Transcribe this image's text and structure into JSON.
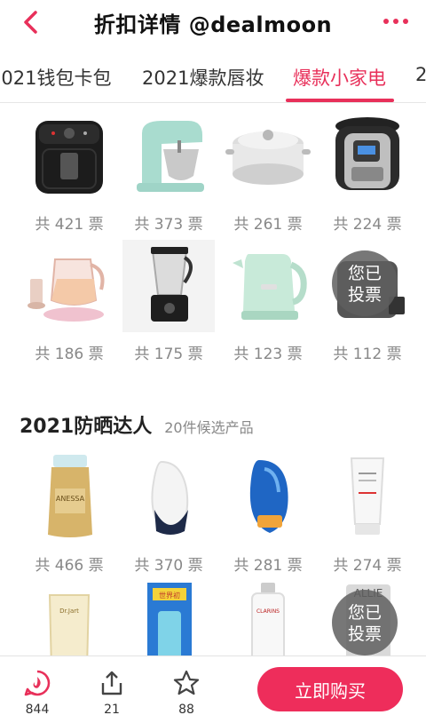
{
  "nav": {
    "title": "折扣详情 @dealmoon"
  },
  "tabs": [
    {
      "label": "2021钱包卡包"
    },
    {
      "label": "2021爆款唇妆"
    },
    {
      "label": "爆款小家电"
    },
    {
      "label": "2"
    }
  ],
  "active_tab": "爆款小家电",
  "appliances": {
    "row1": [
      {
        "votes": "共 421 票"
      },
      {
        "votes": "共 373 票"
      },
      {
        "votes": "共 261 票"
      },
      {
        "votes": "共 224 票"
      }
    ],
    "row2": [
      {
        "votes": "共 186 票"
      },
      {
        "votes": "共 175 票"
      },
      {
        "votes": "共 123 票"
      },
      {
        "votes": "共 112 票",
        "badge": "您已 投票"
      }
    ]
  },
  "sunscreen": {
    "title": "2021防晒达人",
    "count": "20件候选产品",
    "row1": [
      {
        "votes": "共 466 票",
        "brand": "ANESSA"
      },
      {
        "votes": "共 370 票"
      },
      {
        "votes": "共 281 票"
      },
      {
        "votes": "共 274 票"
      }
    ],
    "row2": [
      {
        "brand": "Dr.Jart"
      },
      {
        "brand": "世界初"
      },
      {
        "brand": "CLARINS"
      },
      {
        "brand": "ALLIE",
        "badge": "您已 投票"
      }
    ]
  },
  "bottom": {
    "comments": "844",
    "shares": "21",
    "favorites": "88",
    "buy_label": "立即购买"
  },
  "colors": {
    "accent": "#e8305a",
    "buy_button": "#ee2d5b",
    "vote_text": "#888888"
  }
}
